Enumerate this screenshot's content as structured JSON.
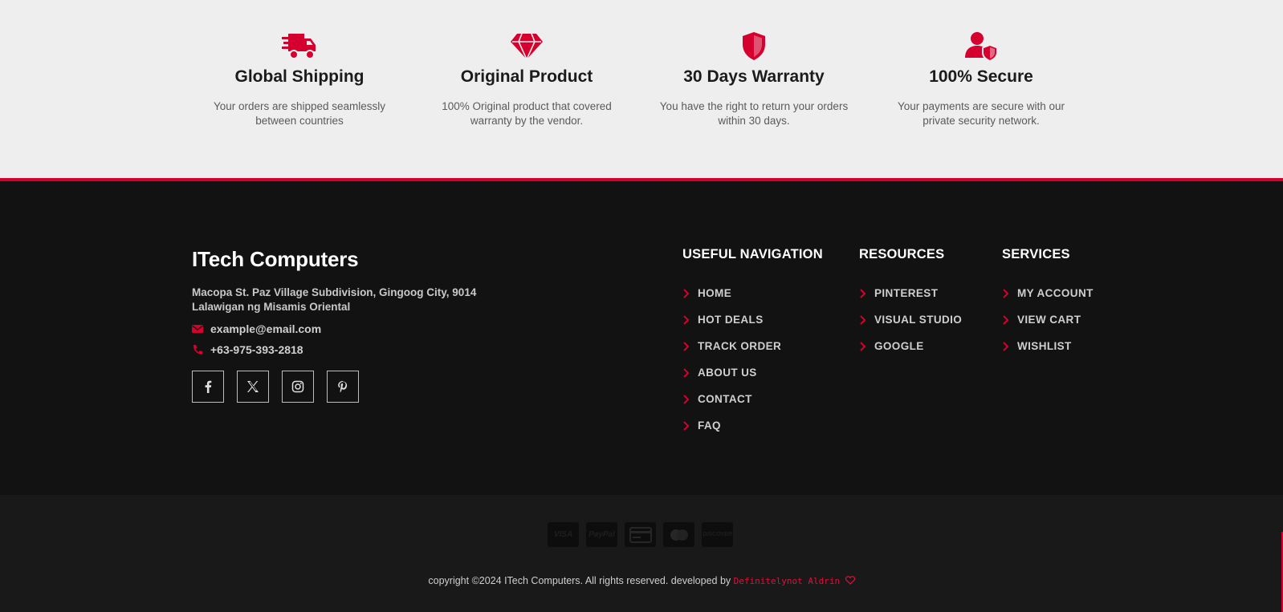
{
  "features": [
    {
      "icon": "truck-icon",
      "title": "Global Shipping",
      "desc": "Your orders are shipped seamlessly between countries"
    },
    {
      "icon": "diamond-icon",
      "title": "Original Product",
      "desc": "100% Original product that covered warranty by the vendor."
    },
    {
      "icon": "shield-icon",
      "title": "30 Days Warranty",
      "desc": "You have the right to return your orders within 30 days."
    },
    {
      "icon": "user-shield-icon",
      "title": "100% Secure",
      "desc": "Your payments are secure with our private security network."
    }
  ],
  "footer": {
    "brand": "ITech Computers",
    "address": "Macopa St. Paz Village Subdivision, Gingoog City, 9014 Lalawigan ng Misamis Oriental",
    "email": "example@email.com",
    "phone": "+63-975-393-2818",
    "socials": [
      "facebook-icon",
      "x-icon",
      "instagram-icon",
      "pinterest-icon"
    ],
    "columns": [
      {
        "title": "USEFUL NAVIGATION",
        "items": [
          "HOME",
          "HOT DEALS",
          "TRACK ORDER",
          "ABOUT US",
          "CONTACT",
          "FAQ"
        ]
      },
      {
        "title": "RESOURCES",
        "items": [
          "PINTEREST",
          "VISUAL STUDIO",
          "GOOGLE"
        ]
      },
      {
        "title": "SERVICES",
        "items": [
          "MY ACCOUNT",
          "VIEW CART",
          "WISHLIST"
        ]
      }
    ]
  },
  "bottom": {
    "payments": [
      "VISA",
      "PayPal",
      "card",
      "mastercard",
      "DISCOVER"
    ],
    "copyright": "copyright ©2024 ITech Computers. All rights reserved. developed by",
    "developer": "Definitelynot Aldrin"
  },
  "colors": {
    "accent": "#d6002e",
    "footer_bg": "#121212",
    "bottom_bg": "#191919",
    "features_bg": "#eeeeee"
  }
}
